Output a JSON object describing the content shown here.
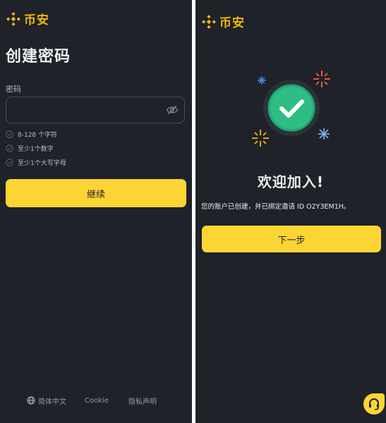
{
  "brand": {
    "name": "币安",
    "color": "#F0B90B"
  },
  "left": {
    "title": "创建密码",
    "password_label": "密码",
    "password_value": "",
    "rules": [
      "8-128 个字符",
      "至少1个数字",
      "至少1个大写字母"
    ],
    "continue_label": "继续",
    "footer": {
      "language": "简体中文",
      "cookie": "Cookie",
      "privacy": "隐私声明"
    }
  },
  "right": {
    "title": "欢迎加入!",
    "subtitle": "您的账户已创建，并已绑定邀请 ID O2Y3EM1H。",
    "next_label": "下一步"
  },
  "colors": {
    "background": "#1F2229",
    "button": "#FCD535",
    "success": "#2EBD85"
  },
  "icons": [
    "binance-logo-icon",
    "eye-off-icon",
    "check-circle-icon",
    "globe-icon",
    "success-check-icon",
    "headset-icon"
  ]
}
